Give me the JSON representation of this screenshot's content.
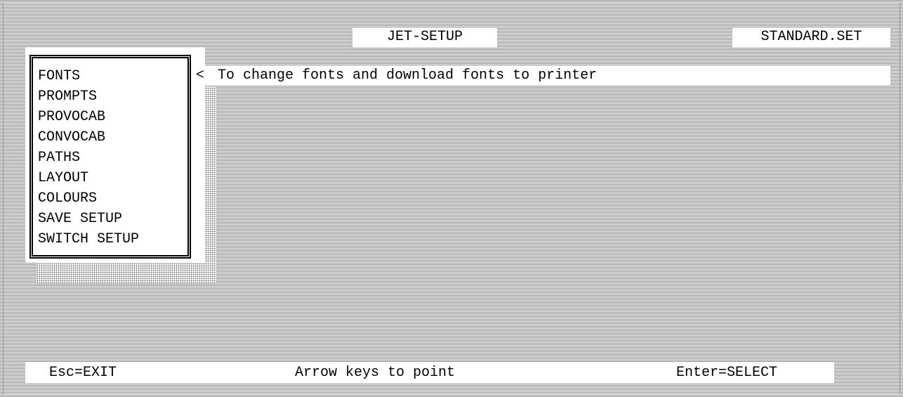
{
  "header": {
    "title": "JET-SETUP",
    "filename": "STANDARD.SET"
  },
  "menu": {
    "items": [
      {
        "label": "FONTS"
      },
      {
        "label": "PROMPTS"
      },
      {
        "label": "PROVOCAB"
      },
      {
        "label": "CONVOCAB"
      },
      {
        "label": "PATHS"
      },
      {
        "label": "LAYOUT"
      },
      {
        "label": "COLOURS"
      },
      {
        "label": "SAVE SETUP"
      },
      {
        "label": "SWITCH SETUP"
      }
    ],
    "selected_index": 0
  },
  "description": {
    "pointer": "<",
    "text": "To change fonts and download fonts to printer"
  },
  "status_bar": {
    "exit": "Esc=EXIT",
    "hint": "Arrow keys to point",
    "select": "Enter=SELECT"
  }
}
